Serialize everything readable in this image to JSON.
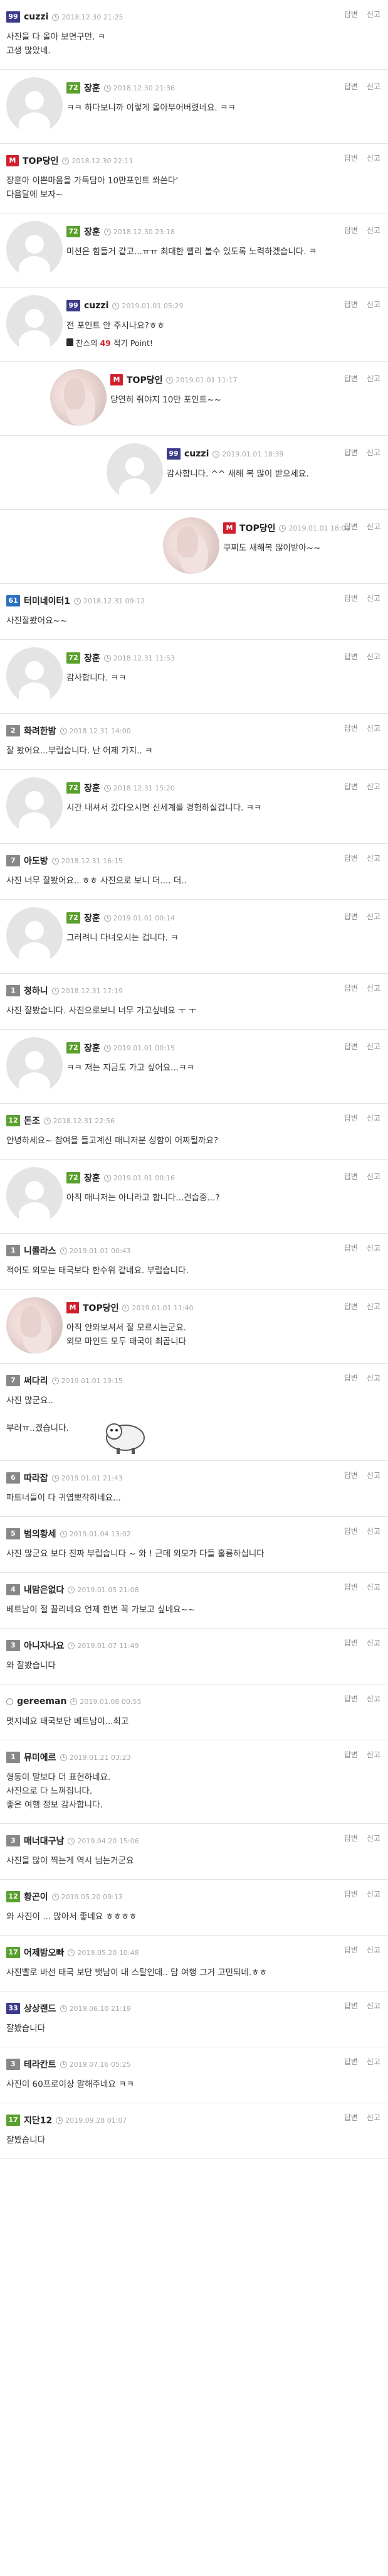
{
  "actions": {
    "reply": "답변",
    "report": "신고"
  },
  "points_notice": {
    "prefix": "찬스의",
    "points": "49",
    "suffix": "적기 Point!"
  },
  "comments": [
    {
      "type": "top",
      "level": "99",
      "level_color": "#3b3b8a",
      "nick": "cuzzi",
      "date": "2018.12.30 21:25",
      "body": "사진을 다 올아 보면구먼. ㅋ\n고생 많았네."
    },
    {
      "type": "avatar",
      "indent": 0,
      "level": "72",
      "level_color": "#5aa02c",
      "nick": "장훈",
      "date": "2018.12.30 21:36",
      "body": "ㅋㅋ 하다보니까 이렇게 올아부어버렸네요. ㅋㅋ"
    },
    {
      "type": "top",
      "logo": "M",
      "nick": "TOP당인",
      "date": "2018.12.30 22:11",
      "body": "장훈아 이쁜마음을 가득담아 10만포인트 쏴쓴다'\n다음달에 보자~"
    },
    {
      "type": "avatar",
      "indent": 0,
      "level": "72",
      "level_color": "#5aa02c",
      "nick": "장훈",
      "date": "2018.12.30 23:18",
      "body": "미션은 힘들거 같고...ㅠㅠ 최대한 빨리 볼수 있도록 노력하겠습니다. ㅋ"
    },
    {
      "type": "avatar",
      "indent": 0,
      "level": "99",
      "level_color": "#3b3b8a",
      "nick": "cuzzi",
      "date": "2019.01.01 05:29",
      "body": "전 포인트 안 주시나요?ㅎㅎ",
      "points": true
    },
    {
      "type": "avatar",
      "indent": 1,
      "photo": true,
      "logo": "M",
      "nick": "TOP당인",
      "date": "2019.01.01 11:17",
      "body": "당연히 줘야지 10만 포인트~~"
    },
    {
      "type": "avatar",
      "indent": 2,
      "level": "99",
      "level_color": "#3b3b8a",
      "nick": "cuzzi",
      "date": "2019.01.01 18:39",
      "body": "감사합니다. ^^ 새해 복 많이 받으세요."
    },
    {
      "type": "avatar",
      "indent": 3,
      "photo": true,
      "logo": "M",
      "nick": "TOP당인",
      "date": "2019.01.01 18:01",
      "body": "쿠찌도 새해복 많이받아~~"
    },
    {
      "type": "top",
      "level": "61",
      "level_color": "#2b6fbf",
      "nick": "터미네이터1",
      "date": "2018.12.31 09:12",
      "body": "사진잘봤어요~~"
    },
    {
      "type": "avatar",
      "indent": 0,
      "level": "72",
      "level_color": "#5aa02c",
      "nick": "장훈",
      "date": "2018.12.31 11:53",
      "body": "감사합니다. ㅋㅋ"
    },
    {
      "type": "top",
      "level": "2",
      "level_color": "#888888",
      "nick": "화려한밤",
      "date": "2018.12.31 14:00",
      "body": "잘 봤어요...부럽습니다. 난 어제 가지.. ㅋ"
    },
    {
      "type": "avatar",
      "indent": 0,
      "level": "72",
      "level_color": "#5aa02c",
      "nick": "장훈",
      "date": "2018.12.31 15:20",
      "body": "시간 내셔서 갔다오시면 신세계를 경험하실겁니다. ㅋㅋ"
    },
    {
      "type": "top",
      "level": "7",
      "level_color": "#888888",
      "nick": "아도방",
      "date": "2018.12.31 16:15",
      "body": "사진 너무 잘봤어요.. ㅎㅎ 사진으로 보니 더.... 더.."
    },
    {
      "type": "avatar",
      "indent": 0,
      "level": "72",
      "level_color": "#5aa02c",
      "nick": "장훈",
      "date": "2019.01.01 00:14",
      "body": "그러려니 다녀오시는 겁니다. ㅋ"
    },
    {
      "type": "top",
      "level": "1",
      "level_color": "#888888",
      "nick": "정하니",
      "date": "2018.12.31 17:19",
      "body": "사진 잘봤습니다. 사진으로보니 너무 가고싶네요 ㅜ ㅜ"
    },
    {
      "type": "avatar",
      "indent": 0,
      "level": "72",
      "level_color": "#5aa02c",
      "nick": "장훈",
      "date": "2019.01.01 00:15",
      "body": "ㅋㅋ 저는 지금도 가고 싶어요...ㅋㅋ"
    },
    {
      "type": "top",
      "level": "12",
      "level_color": "#5aa02c",
      "nick": "돈조",
      "date": "2018.12.31 22:56",
      "body": "안녕하세요~ 참여을 들고계신 매니저분 성함이 어찌될까요?"
    },
    {
      "type": "avatar",
      "indent": 0,
      "level": "72",
      "level_color": "#5aa02c",
      "nick": "장훈",
      "date": "2019.01.01 00:16",
      "body": "아직 매니저는 아니라고 합니다...견습중...?"
    },
    {
      "type": "top",
      "level": "1",
      "level_color": "#888888",
      "nick": "니콜라스",
      "date": "2019.01.01 00:43",
      "body": "적어도 외모는 태국보다 한수위 같네요. 부럽습니다."
    },
    {
      "type": "avatar",
      "indent": 0,
      "photo": true,
      "logo": "M",
      "nick": "TOP당인",
      "date": "2019.01.01 11:40",
      "body": "아직 안와보셔서 잘 모르시는군요.\n외모 마인드 모두 태국이 최곱니다"
    },
    {
      "type": "top",
      "level": "7",
      "level_color": "#888888",
      "nick": "써다리",
      "date": "2019.01.01 19:15",
      "body": "사진 많군요..\n\n부러ㅠ..겠습니다.",
      "sheep": true
    },
    {
      "type": "top",
      "level": "6",
      "level_color": "#888888",
      "nick": "따라잡",
      "date": "2019.01.01 21:43",
      "body": "파트너들이 다 귀엽뽀작하네요..."
    },
    {
      "type": "top",
      "level": "5",
      "level_color": "#888888",
      "nick": "범의황세",
      "date": "2019.01.04 13:02",
      "body": "사진 많군요 보다 진짜 부럽습니다 ~ 와 ! 근데 외모가 다들 훌륭하십니다"
    },
    {
      "type": "top",
      "level": "4",
      "level_color": "#888888",
      "nick": "내맘은없다",
      "date": "2019.01.05 21:08",
      "body": "베트남이 절 끌리네요 언제 한번 꼭 가보고 싶네요~~"
    },
    {
      "type": "top",
      "level": "3",
      "level_color": "#888888",
      "nick": "아니자나요",
      "date": "2019.01.07 11:49",
      "body": "와 잘봤습니다"
    },
    {
      "type": "top",
      "usericon": true,
      "nick": "gereeman",
      "date": "2019.01.08 00:55",
      "body": "멋지네요 태국보단 베트남이...최고"
    },
    {
      "type": "top",
      "level": "1",
      "level_color": "#888888",
      "nick": "뮤미에르",
      "date": "2019.01.21 03:23",
      "body": "형동이 말보다 더 표현하네요.\n사진으로 다 느껴집니다.\n좋은 여행 정보 감사합니다."
    },
    {
      "type": "top",
      "level": "3",
      "level_color": "#888888",
      "nick": "매너대구남",
      "date": "2019.04.20 15:06",
      "body": "사진을 많이 찍는게 역시 넘는거군요"
    },
    {
      "type": "top",
      "level": "12",
      "level_color": "#5aa02c",
      "nick": "황곤이",
      "date": "2019.05.20 09:13",
      "body": "와 사진이 ... 많아서 좋네요 ㅎㅎㅎㅎ"
    },
    {
      "type": "top",
      "level": "17",
      "level_color": "#5aa02c",
      "nick": "어제밤오빠",
      "date": "2019.05.20 10:48",
      "body": "사진빨로 바선 태국 보단 뱃남이 내 스탈인데.. 담 여행 그거 고민되네.ㅎㅎ"
    },
    {
      "type": "top",
      "level": "33",
      "level_color": "#3b3b8a",
      "nick": "상상랜드",
      "date": "2019.06.10 21:19",
      "body": "잘봤습니다"
    },
    {
      "type": "top",
      "level": "3",
      "level_color": "#888888",
      "nick": "테라칸트",
      "date": "2019.07.16 05:25",
      "body": "사진이 60프로이상 말해주네요 ㅋㅋ"
    },
    {
      "type": "top",
      "level": "17",
      "level_color": "#5aa02c",
      "nick": "지단12",
      "date": "2019.09.28 01:07",
      "body": "잘봤습니다"
    }
  ]
}
